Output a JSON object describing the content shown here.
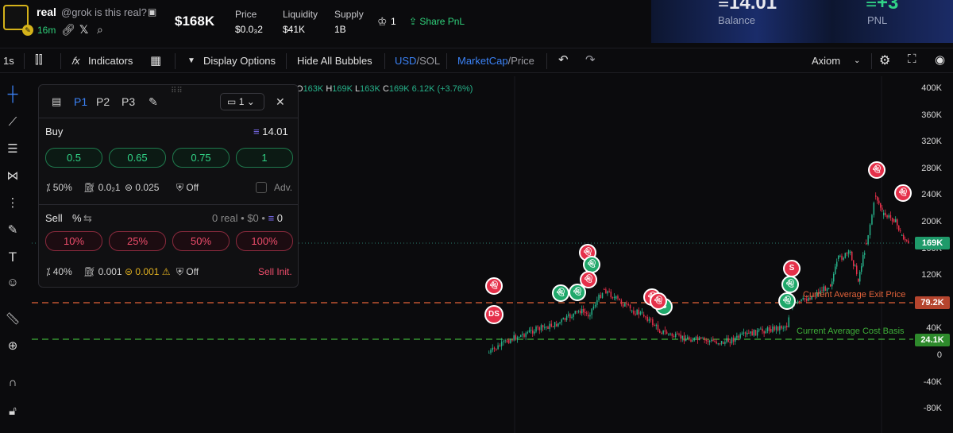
{
  "token": {
    "name": "real",
    "subtitle": "@grok is this real?",
    "age": "16m",
    "market_cap": "$168K",
    "stats": [
      {
        "label": "Price",
        "value": "$0.0₃2"
      },
      {
        "label": "Liquidity",
        "value": "$41K"
      },
      {
        "label": "Supply",
        "value": "1B"
      }
    ],
    "holders_count": "1",
    "share_label": "Share PnL"
  },
  "pnl_card": {
    "balance_value": "14.01",
    "balance_label": "Balance",
    "pnl_value": "+3",
    "pnl_label": "PNL"
  },
  "toolbar": {
    "interval": "1s",
    "indicators": "Indicators",
    "display_options": "Display Options",
    "hide_bubbles": "Hide All Bubbles",
    "currency_usd": "USD",
    "currency_sol": "SOL",
    "metric_mc": "MarketCap",
    "metric_price": "Price",
    "source": "Axiom",
    "slash": "/"
  },
  "chart": {
    "ohlc": {
      "o_label": "O",
      "o": "163K",
      "h_label": "H",
      "h": "169K",
      "l_label": "L",
      "l": "163K",
      "c_label": "C",
      "c": "169K",
      "change": "6.12K (+3.76%)"
    },
    "y_ticks": [
      "400K",
      "360K",
      "320K",
      "280K",
      "240K",
      "200K",
      "160K",
      "120K",
      "80K",
      "40K",
      "0",
      "-40K",
      "-80K"
    ],
    "current_price_tag": "169K",
    "exit_price_tag": "79.2K",
    "cost_basis_tag": "24.1K",
    "exit_label": "Current Average Exit Price",
    "cost_label": "Current Average Cost Basis",
    "colors": {
      "up": "#26b28a",
      "down": "#e5304a",
      "exit_line": "#e2623a",
      "cost_line": "#3fae3a"
    },
    "bubbles": [
      {
        "type": "red",
        "text": "DS"
      },
      {
        "type": "red",
        "text": "S"
      },
      {
        "type": "green",
        "text": "B"
      }
    ]
  },
  "panel": {
    "tabs": [
      "P1",
      "P2",
      "P3"
    ],
    "preset_select": "1",
    "buy": {
      "title": "Buy",
      "balance": "14.01",
      "amounts": [
        "0.5",
        "0.65",
        "0.75",
        "1"
      ],
      "slippage": "50%",
      "priority": "0.0₂1",
      "bribe": "0.025",
      "mev": "Off",
      "adv": "Adv."
    },
    "sell": {
      "title": "Sell",
      "mode": "%",
      "holdings": "0 real",
      "holdings_usd": "$0",
      "holdings_sol": "0",
      "amounts": [
        "10%",
        "25%",
        "50%",
        "100%"
      ],
      "slippage": "40%",
      "priority": "0.001",
      "bribe": "0.001",
      "mev": "Off",
      "sell_init": "Sell Init."
    }
  }
}
